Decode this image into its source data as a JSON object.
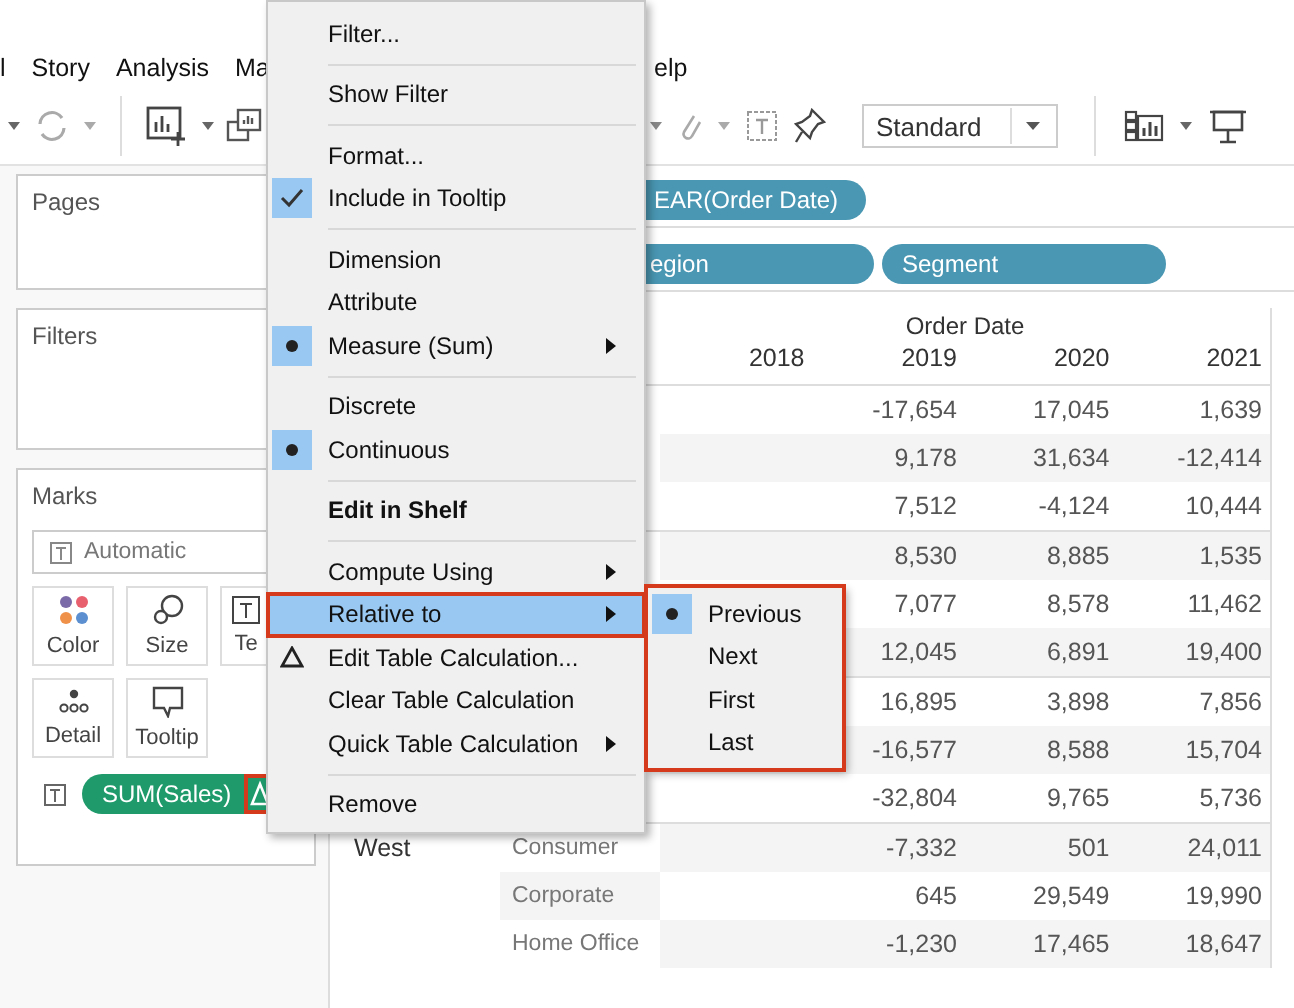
{
  "menu_bar": {
    "left": [
      "l",
      "Story",
      "Analysis",
      "Ma"
    ],
    "right": [
      "elp"
    ]
  },
  "toolbar": {
    "mark_type": "Standard"
  },
  "left_panel": {
    "pages": {
      "title": "Pages"
    },
    "filters": {
      "title": "Filters"
    },
    "marks": {
      "title": "Marks",
      "mark_type": "Automatic",
      "tiles": [
        {
          "label": "Color",
          "kind": "color"
        },
        {
          "label": "Size",
          "kind": "size"
        },
        {
          "label": "Te",
          "kind": "text"
        },
        {
          "label": "Detail",
          "kind": "detail"
        },
        {
          "label": "Tooltip",
          "kind": "tooltip"
        }
      ],
      "pill": {
        "label": "SUM(Sales)",
        "table_calc_highlighted": true
      }
    }
  },
  "shelves": {
    "columns": [
      {
        "label": "EAR(Order Date)"
      }
    ],
    "rows": [
      {
        "label": "egion"
      },
      {
        "label": "Segment"
      }
    ]
  },
  "table": {
    "header": "Order Date",
    "columns": [
      "2018",
      "2019",
      "2020",
      "2021"
    ],
    "rows": [
      {
        "values": [
          "-17,654",
          "17,045",
          "1,639"
        ]
      },
      {
        "values": [
          "9,178",
          "31,634",
          "-12,414"
        ]
      },
      {
        "values": [
          "7,512",
          "-4,124",
          "10,444"
        ]
      },
      {
        "values": [
          "8,530",
          "8,885",
          "1,535"
        ]
      },
      {
        "values": [
          "7,077",
          "8,578",
          "11,462"
        ]
      },
      {
        "values": [
          "12,045",
          "6,891",
          "19,400"
        ]
      },
      {
        "values": [
          "16,895",
          "3,898",
          "7,856"
        ]
      },
      {
        "values": [
          "-16,577",
          "8,588",
          "15,704"
        ]
      },
      {
        "values": [
          "-32,804",
          "9,765",
          "5,736"
        ]
      },
      {
        "region": "West",
        "segment": "Consumer",
        "values": [
          "-7,332",
          "501",
          "24,011"
        ]
      },
      {
        "segment": "Corporate",
        "values": [
          "645",
          "29,549",
          "19,990"
        ]
      },
      {
        "segment": "Home Office",
        "values": [
          "-1,230",
          "17,465",
          "18,647"
        ]
      }
    ]
  },
  "context_menu": {
    "sections": [
      [
        {
          "label": "Filter...",
          "kind": "plain",
          "selected": false
        }
      ],
      [
        {
          "label": "Show Filter",
          "kind": "plain",
          "selected": false
        }
      ],
      [
        {
          "label": "Format...",
          "kind": "plain",
          "selected": false
        },
        {
          "label": "Include in Tooltip",
          "kind": "check",
          "checked": true,
          "selected": false
        }
      ],
      [
        {
          "label": "Dimension",
          "kind": "radio",
          "checked": false,
          "selected": false
        },
        {
          "label": "Attribute",
          "kind": "radio",
          "checked": false,
          "selected": false
        },
        {
          "label": "Measure (Sum)",
          "kind": "radio",
          "checked": true,
          "submenu": true,
          "selected": false
        }
      ],
      [
        {
          "label": "Discrete",
          "kind": "radio",
          "checked": false,
          "selected": false
        },
        {
          "label": "Continuous",
          "kind": "radio",
          "checked": true,
          "selected": false
        }
      ],
      [
        {
          "label": "Edit in Shelf",
          "kind": "plain",
          "bold": true,
          "selected": false
        }
      ],
      [
        {
          "label": "Compute Using",
          "kind": "plain",
          "submenu": true,
          "selected": false
        },
        {
          "label": "Relative to",
          "kind": "plain",
          "submenu": true,
          "selected": true,
          "highlight_box": true
        },
        {
          "label": "Edit Table Calculation...",
          "kind": "calc",
          "selected": false
        },
        {
          "label": "Clear Table Calculation",
          "kind": "plain",
          "selected": false
        },
        {
          "label": "Quick Table Calculation",
          "kind": "plain",
          "submenu": true,
          "selected": false
        }
      ],
      [
        {
          "label": "Remove",
          "kind": "plain",
          "selected": false
        }
      ]
    ]
  },
  "submenu": {
    "highlight_box": true,
    "items": [
      {
        "label": "Previous",
        "checked": true
      },
      {
        "label": "Next",
        "checked": false
      },
      {
        "label": "First",
        "checked": false
      },
      {
        "label": "Last",
        "checked": false
      }
    ]
  }
}
